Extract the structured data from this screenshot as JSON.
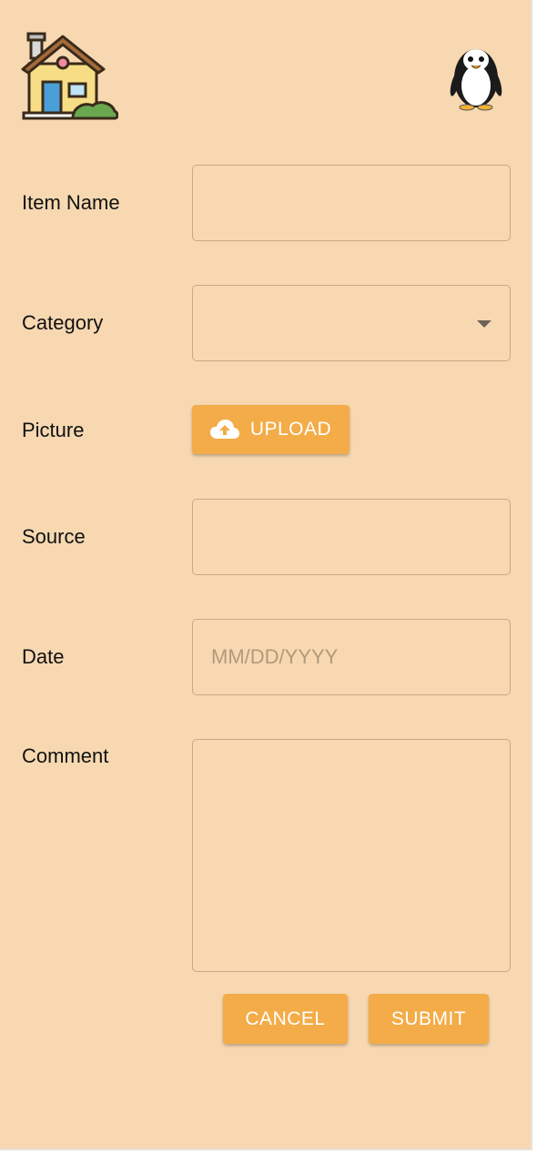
{
  "header": {
    "logo_icon": "house-icon",
    "avatar_icon": "penguin-icon"
  },
  "form": {
    "item_name": {
      "label": "Item Name",
      "value": ""
    },
    "category": {
      "label": "Category",
      "value": ""
    },
    "picture": {
      "label": "Picture",
      "upload_label": "UPLOAD",
      "icon": "cloud-upload-icon"
    },
    "source": {
      "label": "Source",
      "value": ""
    },
    "date": {
      "label": "Date",
      "placeholder": "MM/DD/YYYY",
      "value": ""
    },
    "comment": {
      "label": "Comment",
      "value": ""
    }
  },
  "actions": {
    "cancel_label": "CANCEL",
    "submit_label": "SUBMIT"
  },
  "colors": {
    "background": "#f7d8b1",
    "accent": "#f3ac48",
    "field_border": "#c8a985"
  }
}
